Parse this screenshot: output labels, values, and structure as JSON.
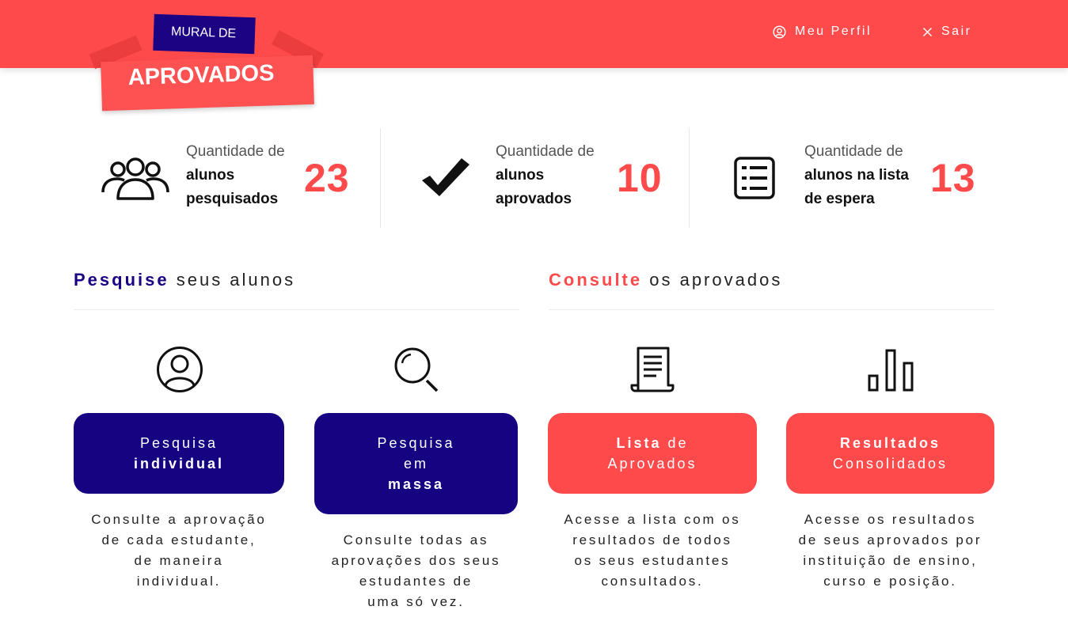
{
  "header": {
    "logo_top": "MURAL DE",
    "logo_main": "APROVADOS",
    "profile_label": "Meu Perfil",
    "logout_label": "Sair"
  },
  "stats": [
    {
      "prefix": "Quantidade de",
      "label_1": "alunos",
      "label_2": "pesquisados",
      "value": "23",
      "icon": "group-icon"
    },
    {
      "prefix": "Quantidade de",
      "label_1": "alunos",
      "label_2": "aprovados",
      "value": "10",
      "icon": "checkmark-icon"
    },
    {
      "prefix": "Quantidade de",
      "label_1": "alunos na lista",
      "label_2": "de espera",
      "value": "13",
      "icon": "list-icon"
    }
  ],
  "sections": {
    "search": {
      "bold": "Pesquise",
      "rest": " seus alunos"
    },
    "consult": {
      "bold": "Consulte",
      "rest": " os aprovados"
    }
  },
  "actions": [
    {
      "icon": "user-circle-icon",
      "button_lines": [
        {
          "text": "Pesquisa",
          "bold": false
        },
        {
          "text": "individual",
          "bold": true
        }
      ],
      "description": [
        "Consulte a aprovação",
        "de cada estudante,",
        "de maneira",
        "individual."
      ]
    },
    {
      "icon": "search-icon",
      "button_lines": [
        {
          "text": "Pesquisa",
          "bold": false
        },
        {
          "text": "em",
          "bold": false
        },
        {
          "text": "massa",
          "bold": true
        }
      ],
      "description": [
        "Consulte todas as",
        "aprovações dos seus",
        "estudantes de",
        "uma só vez."
      ]
    },
    {
      "icon": "document-scroll-icon",
      "button_lines": [
        {
          "text": "Lista",
          "bold": true,
          "suffix": " de"
        },
        {
          "text": "Aprovados",
          "bold": false
        }
      ],
      "description": [
        "Acesse a lista com os",
        "resultados de todos",
        "os seus estudantes",
        "consultados."
      ]
    },
    {
      "icon": "bar-chart-icon",
      "button_lines": [
        {
          "text": "Resultados",
          "bold": true
        },
        {
          "text": "Consolidados",
          "bold": false
        }
      ],
      "description": [
        "Acesse os resultados",
        "de seus aprovados por",
        "instituição de ensino,",
        "curso e posição."
      ]
    }
  ],
  "colors": {
    "brand_red": "#fe4a4b",
    "brand_blue": "#150382"
  }
}
